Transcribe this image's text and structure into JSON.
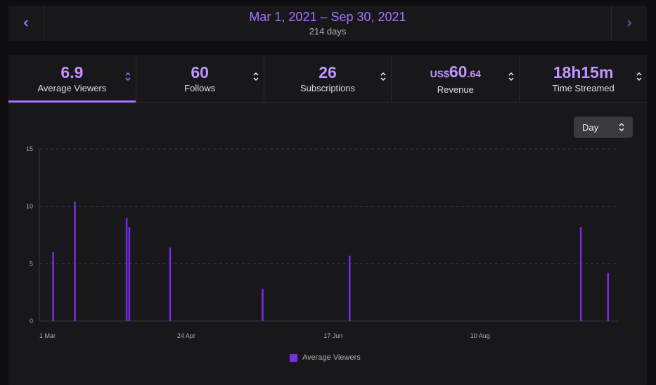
{
  "date_range": {
    "label": "Mar 1, 2021 – Sep 30, 2021",
    "days": "214 days"
  },
  "stats": [
    {
      "value": "6.9",
      "label": "Average Viewers",
      "active": true
    },
    {
      "value": "60",
      "label": "Follows",
      "active": false
    },
    {
      "value": "26",
      "label": "Subscriptions",
      "active": false
    },
    {
      "prefix": "US$",
      "value": "60",
      "decimal": ".64",
      "label": "Revenue",
      "active": false
    },
    {
      "value": "18h15m",
      "label": "Time Streamed",
      "active": false
    }
  ],
  "granularity_select": {
    "value": "Day"
  },
  "colors": {
    "accent": "#a970ff",
    "bar": "#772ce8"
  },
  "icons": {
    "prev": "chevron-left-icon",
    "next": "chevron-right-icon",
    "sort": "sort-updown-icon"
  },
  "chart_data": {
    "type": "bar",
    "x_start": "2021-03-01",
    "x_end": "2021-09-30",
    "xtick_labels": [
      {
        "date": "2021-03-01",
        "label": "1 Mar"
      },
      {
        "date": "2021-04-24",
        "label": "24 Apr"
      },
      {
        "date": "2021-06-17",
        "label": "17 Jun"
      },
      {
        "date": "2021-08-10",
        "label": "10 Aug"
      }
    ],
    "yticks": [
      0,
      5,
      10,
      15
    ],
    "ylim": [
      0,
      15
    ],
    "grid": true,
    "legend_position": "bottom",
    "series": [
      {
        "name": "Average Viewers",
        "points": [
          {
            "date": "2021-03-06",
            "value": 6.0
          },
          {
            "date": "2021-03-14",
            "value": 10.4
          },
          {
            "date": "2021-04-02",
            "value": 9.0
          },
          {
            "date": "2021-04-03",
            "value": 8.2
          },
          {
            "date": "2021-04-18",
            "value": 6.4
          },
          {
            "date": "2021-05-22",
            "value": 2.8
          },
          {
            "date": "2021-06-23",
            "value": 5.7
          },
          {
            "date": "2021-09-16",
            "value": 8.2
          },
          {
            "date": "2021-09-26",
            "value": 4.2
          }
        ]
      }
    ]
  }
}
